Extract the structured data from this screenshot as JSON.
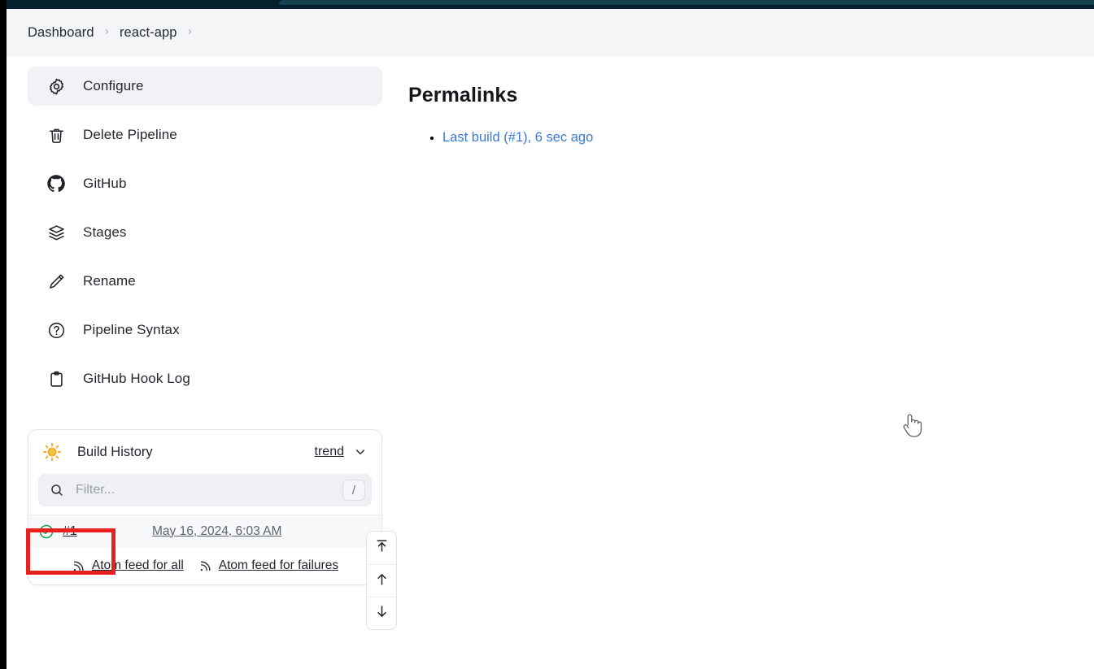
{
  "window": {
    "topbar_color": "#04202c",
    "accent_link_color": "#3a7ad5",
    "annotation_color": "#e8201e"
  },
  "breadcrumb": {
    "items": [
      {
        "label": "Dashboard",
        "icon": "none"
      },
      {
        "label": "react-app",
        "icon": "none"
      }
    ],
    "separator": "›"
  },
  "sidebar": {
    "items": [
      {
        "label": "Configure",
        "icon": "gear-icon",
        "active": true
      },
      {
        "label": "Delete Pipeline",
        "icon": "trash-icon",
        "active": false
      },
      {
        "label": "GitHub",
        "icon": "github-icon",
        "active": false
      },
      {
        "label": "Stages",
        "icon": "layers-icon",
        "active": false
      },
      {
        "label": "Rename",
        "icon": "pencil-icon",
        "active": false
      },
      {
        "label": "Pipeline Syntax",
        "icon": "question-circle-icon",
        "active": false
      },
      {
        "label": "GitHub Hook Log",
        "icon": "clipboard-icon",
        "active": false
      }
    ]
  },
  "build_history": {
    "title": "Build History",
    "icon": "weather-sun-icon",
    "trend_label": "trend",
    "trend_chevron": "chevron-down-icon",
    "filter": {
      "placeholder": "Filter...",
      "value": "",
      "shortcut": "/",
      "icon": "search-icon"
    },
    "builds": [
      {
        "number": "#1",
        "timestamp": "May 16, 2024, 6:03 AM",
        "status": "success",
        "status_icon": "check-circle-icon",
        "status_color": "#1f9e4e"
      }
    ],
    "feeds": [
      {
        "label": "Atom feed for all",
        "icon": "rss-icon"
      },
      {
        "label": "Atom feed for failures",
        "icon": "rss-icon"
      }
    ]
  },
  "scroll_nav": {
    "buttons": [
      {
        "name": "scroll-to-top",
        "icon": "arrow-to-top-icon"
      },
      {
        "name": "scroll-up",
        "icon": "arrow-up-icon"
      },
      {
        "name": "scroll-down",
        "icon": "arrow-down-icon"
      }
    ]
  },
  "main": {
    "heading": "Permalinks",
    "links": [
      {
        "label": "Last build (#1), 6 sec ago"
      }
    ]
  },
  "cursor": {
    "type": "pointer-hand"
  }
}
